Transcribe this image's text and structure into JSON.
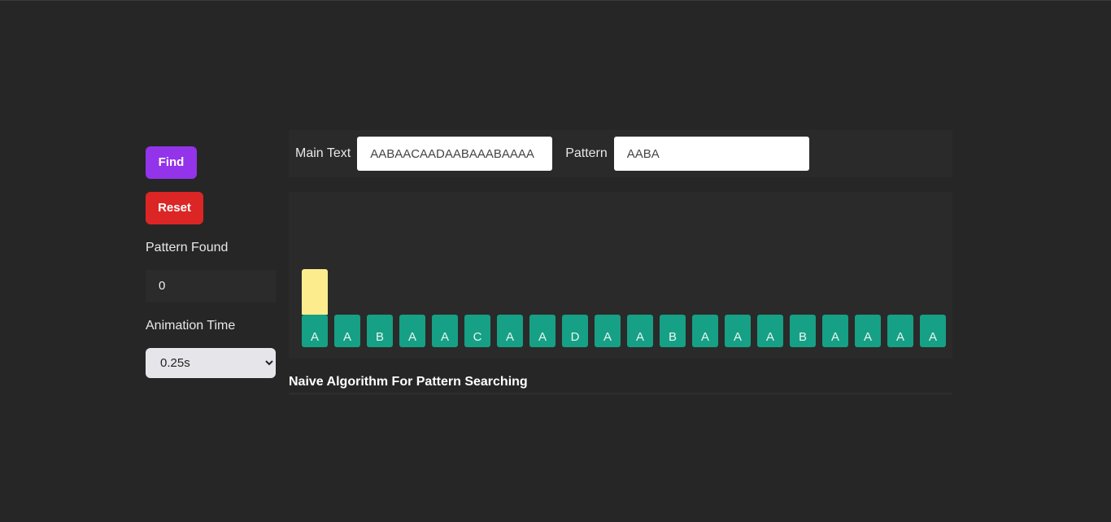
{
  "sidebar": {
    "find_label": "Find",
    "reset_label": "Reset",
    "pattern_found_label": "Pattern Found",
    "pattern_found_value": "0",
    "animation_time_label": "Animation Time",
    "animation_time_value": "0.25s"
  },
  "inputs": {
    "main_text_label": "Main Text",
    "main_text_value": "AABAACAADAABAAABAAAA",
    "pattern_label": "Pattern",
    "pattern_value": "AABA"
  },
  "visualizer": {
    "characters": [
      "A",
      "A",
      "B",
      "A",
      "A",
      "C",
      "A",
      "A",
      "D",
      "A",
      "A",
      "B",
      "A",
      "A",
      "A",
      "B",
      "A",
      "A",
      "A",
      "A"
    ],
    "pointer_index": 0
  },
  "title": "Naive Algorithm For Pattern Searching",
  "colors": {
    "background": "#262626",
    "panel": "#2a2a2a",
    "find_button": "#9333ea",
    "reset_button": "#dc2626",
    "cell": "#16a085",
    "pointer": "#fdec8e"
  }
}
